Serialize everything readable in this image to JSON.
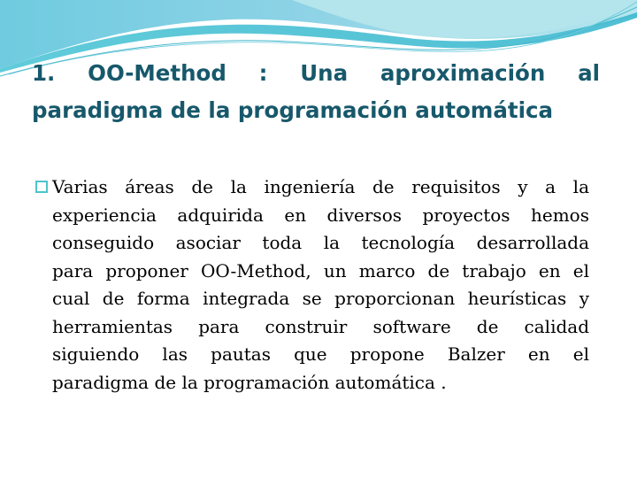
{
  "slide": {
    "title_lines": [
      "1. OO-Method : Una aproximación al",
      "paradigma de la programación automática"
    ],
    "bullets": [
      {
        "icon": "hollow-square-bullet-icon",
        "lines": [
          "Varias áreas de la ingeniería de requisitos y a la",
          "experiencia adquirida en diversos proyectos hemos",
          "conseguido asociar toda la tecnología desarrollada",
          "para proponer OO-Method, un marco de trabajo en el",
          "cual de forma integrada se proporcionan heurísticas y",
          "herramientas para construir software de calidad",
          "siguiendo las pautas que propone Balzer en el",
          "paradigma de la programación automática ."
        ]
      }
    ]
  },
  "colors": {
    "title": "#17586b",
    "bullet": "#4cc4cc",
    "wave_light": "#a9e0ea",
    "wave_dark": "#5cc8d8"
  }
}
